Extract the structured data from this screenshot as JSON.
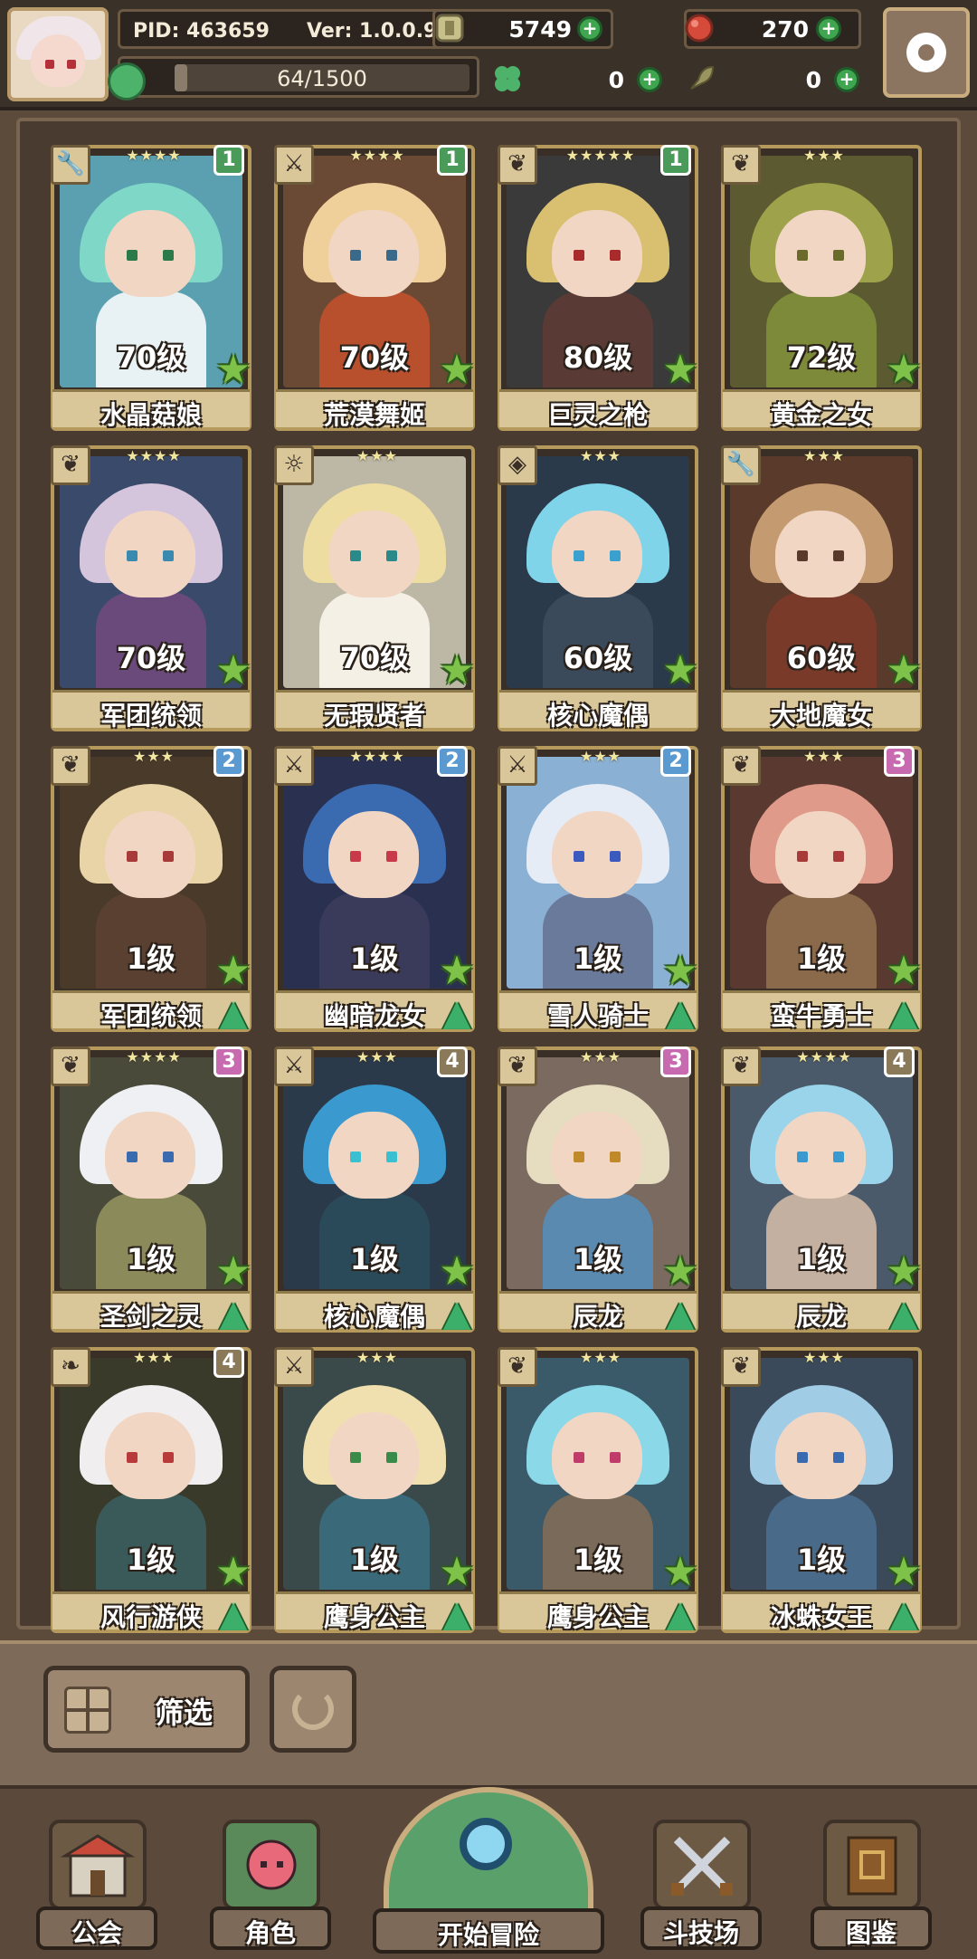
{
  "header": {
    "pid": "PID: 463659",
    "version": "Ver: 1.0.0.9",
    "energy": "64/1500",
    "energy_fraction": 0.043,
    "resources": [
      {
        "name": "gold-coin",
        "value": "5749"
      },
      {
        "name": "red-gem",
        "value": "270"
      },
      {
        "name": "clover",
        "value": "0"
      },
      {
        "name": "leaf-token",
        "value": "0"
      }
    ]
  },
  "cards": [
    {
      "name": "水晶菇娘",
      "level": "70级",
      "stars": "★★★★",
      "rank": "1",
      "rank_color": "#4a9a5a",
      "class": "wrench-icon",
      "hair": "#7fd7c7",
      "body": "#e8f2f4",
      "bg": "#5aa0b0",
      "eye": "#2a7a4a",
      "show_up": false
    },
    {
      "name": "荒漠舞姬",
      "level": "70级",
      "stars": "★★★★",
      "rank": "1",
      "rank_color": "#4a9a5a",
      "class": "sword-icon",
      "hair": "#f0d09a",
      "body": "#b8502e",
      "bg": "#6a4a34",
      "eye": "#3a6a8a",
      "show_up": false
    },
    {
      "name": "巨灵之枪",
      "level": "80级",
      "stars": "★★★★★",
      "rank": "1",
      "rank_color": "#4a9a5a",
      "class": "feather-icon",
      "hair": "#d9c070",
      "body": "#5a3a34",
      "bg": "#3a3a3a",
      "eye": "#a82a2a",
      "show_up": false
    },
    {
      "name": "黄金之女",
      "level": "72级",
      "stars": "★★★",
      "rank": "",
      "rank_color": "",
      "class": "feather-icon",
      "hair": "#9ea24a",
      "body": "#7c8a3a",
      "bg": "#5c5a30",
      "eye": "#6a6a2a",
      "show_up": false
    },
    {
      "name": "军团统领",
      "level": "70级",
      "stars": "★★★★",
      "rank": "",
      "rank_color": "",
      "class": "feather-icon",
      "hair": "#d4c4dc",
      "body": "#6a4a7a",
      "bg": "#3a4a6a",
      "eye": "#3a8ab0",
      "show_up": false
    },
    {
      "name": "无瑕贤者",
      "level": "70级",
      "stars": "★★★",
      "rank": "",
      "rank_color": "",
      "class": "gear-icon",
      "hair": "#eedda0",
      "body": "#f4f0e6",
      "bg": "#bdb8a6",
      "eye": "#2a8a8a",
      "show_up": false
    },
    {
      "name": "核心魔偶",
      "level": "60级",
      "stars": "★★★",
      "rank": "",
      "rank_color": "",
      "class": "shield-icon",
      "hair": "#7fd4ea",
      "body": "#3a4a5a",
      "bg": "#2a3a4a",
      "eye": "#3aa0d0",
      "show_up": false
    },
    {
      "name": "大地魔女",
      "level": "60级",
      "stars": "★★★",
      "rank": "",
      "rank_color": "",
      "class": "wrench-icon",
      "hair": "#c49a70",
      "body": "#7a3a2a",
      "bg": "#5a3a2a",
      "eye": "#5a3a2a",
      "show_up": false
    },
    {
      "name": "军团统领",
      "level": "1级",
      "stars": "★★★",
      "rank": "2",
      "rank_color": "#5a9ad0",
      "class": "feather-icon",
      "hair": "#e8d4a6",
      "body": "#5a4030",
      "bg": "#4a3a2a",
      "eye": "#a83a3a",
      "show_up": true
    },
    {
      "name": "幽暗龙女",
      "level": "1级",
      "stars": "★★★★",
      "rank": "2",
      "rank_color": "#5a9ad0",
      "class": "sword-icon",
      "hair": "#3a6ab0",
      "body": "#3a3a5a",
      "bg": "#2a3050",
      "eye": "#c83a4a",
      "show_up": true
    },
    {
      "name": "雪人骑士",
      "level": "1级",
      "stars": "★★★",
      "rank": "2",
      "rank_color": "#5a9ad0",
      "class": "sword-icon",
      "hair": "#e6ecf6",
      "body": "#6a7a9a",
      "bg": "#8ab0d4",
      "eye": "#3a5ac0",
      "show_up": true
    },
    {
      "name": "蛮牛勇士",
      "level": "1级",
      "stars": "★★★",
      "rank": "3",
      "rank_color": "#c86ab0",
      "class": "feather-icon",
      "hair": "#e09a8a",
      "body": "#8a6a4a",
      "bg": "#5a3a30",
      "eye": "#a83a3a",
      "show_up": true
    },
    {
      "name": "圣剑之灵",
      "level": "1级",
      "stars": "★★★★",
      "rank": "3",
      "rank_color": "#c86ab0",
      "class": "feather-icon",
      "hair": "#eef0f4",
      "body": "#8a8a5a",
      "bg": "#4a4a3a",
      "eye": "#3a6ab0",
      "show_up": true
    },
    {
      "name": "核心魔偶",
      "level": "1级",
      "stars": "★★★",
      "rank": "4",
      "rank_color": "#8a7a5a",
      "class": "sword-icon",
      "hair": "#3a9ad0",
      "body": "#2a4a5a",
      "bg": "#2a3a4a",
      "eye": "#3ac0d0",
      "show_up": true
    },
    {
      "name": "辰龙",
      "level": "1级",
      "stars": "★★★",
      "rank": "3",
      "rank_color": "#c86ab0",
      "class": "feather-icon",
      "hair": "#e6dcc0",
      "body": "#5a8ab0",
      "bg": "#7a6a60",
      "eye": "#c08a2a",
      "show_up": true
    },
    {
      "name": "辰龙",
      "level": "1级",
      "stars": "★★★★",
      "rank": "4",
      "rank_color": "#8a7a5a",
      "class": "feather-icon",
      "hair": "#9ad4ea",
      "body": "#c4b0a0",
      "bg": "#4a5a6a",
      "eye": "#3a9ad0",
      "show_up": true
    },
    {
      "name": "风行游侠",
      "level": "1级",
      "stars": "★★★",
      "rank": "4",
      "rank_color": "#8a7a5a",
      "class": "leaf-icon",
      "hair": "#f0eeee",
      "body": "#3a5a5a",
      "bg": "#3a3a2a",
      "eye": "#b83a3a",
      "show_up": true
    },
    {
      "name": "鹰身公主",
      "level": "1级",
      "stars": "★★★",
      "rank": "",
      "rank_color": "",
      "class": "sword-icon",
      "hair": "#f0e0b0",
      "body": "#3a6a7a",
      "bg": "#3a4a4a",
      "eye": "#3a8a4a",
      "show_up": true
    },
    {
      "name": "鹰身公主",
      "level": "1级",
      "stars": "★★★",
      "rank": "",
      "rank_color": "",
      "class": "feather-icon",
      "hair": "#8ad8e8",
      "body": "#7a6a5a",
      "bg": "#3a5a6a",
      "eye": "#c03a6a",
      "show_up": true
    },
    {
      "name": "冰蛛女王",
      "level": "1级",
      "stars": "★★★",
      "rank": "",
      "rank_color": "",
      "class": "feather-icon",
      "hair": "#a0cce6",
      "body": "#4a6a8a",
      "bg": "#3a4a5a",
      "eye": "#3a6ab0",
      "show_up": true
    }
  ],
  "filter": {
    "label": "筛选"
  },
  "nav": {
    "guild": "公会",
    "character": "角色",
    "start": "开始冒险",
    "arena": "斗技场",
    "codex": "图鉴"
  }
}
